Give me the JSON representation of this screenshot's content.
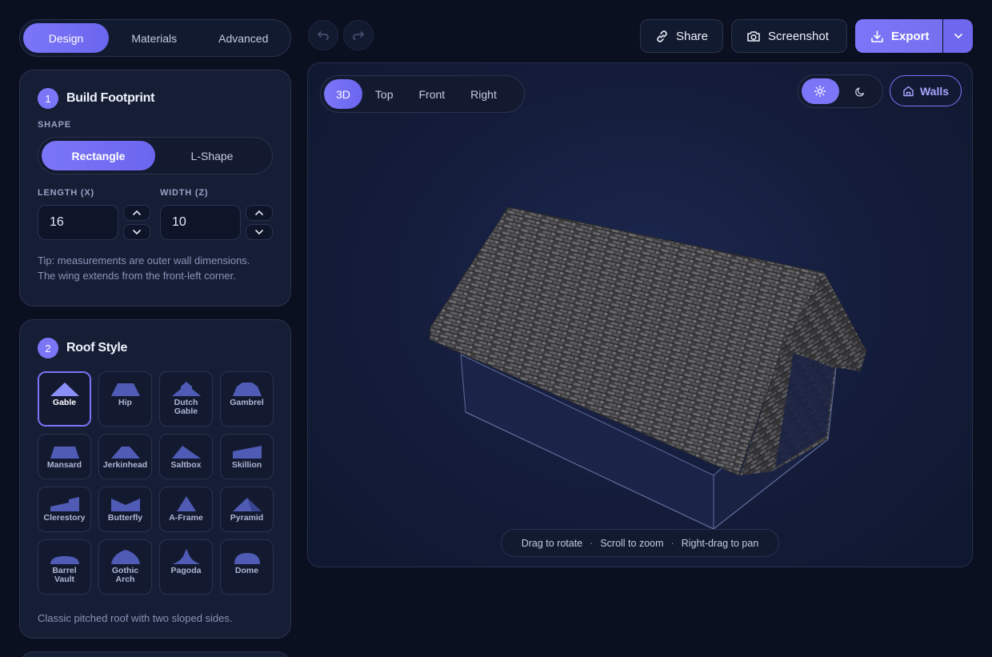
{
  "mode_tabs": [
    "Design",
    "Materials",
    "Advanced"
  ],
  "footprint": {
    "step": "1",
    "title": "Build Footprint",
    "shape_label": "SHAPE",
    "shapes": [
      "Rectangle",
      "L-Shape"
    ],
    "length_label": "LENGTH (X)",
    "length_value": "16",
    "width_label": "WIDTH (Z)",
    "width_value": "10",
    "tip_line1": "Tip: measurements are outer wall dimensions.",
    "tip_line2": "The wing extends from the front-left corner."
  },
  "roof": {
    "step": "2",
    "title": "Roof Style",
    "styles": [
      {
        "l1": "Gable",
        "l2": "",
        "icon": "gable-icon"
      },
      {
        "l1": "Hip",
        "l2": "",
        "icon": "hip-icon"
      },
      {
        "l1": "Dutch",
        "l2": "Gable",
        "icon": "dutch-gable-icon"
      },
      {
        "l1": "Gambrel",
        "l2": "",
        "icon": "gambrel-icon"
      },
      {
        "l1": "Mansard",
        "l2": "",
        "icon": "mansard-icon"
      },
      {
        "l1": "Jerkinhead",
        "l2": "",
        "icon": "jerkinhead-icon"
      },
      {
        "l1": "Saltbox",
        "l2": "",
        "icon": "saltbox-icon"
      },
      {
        "l1": "Skillion",
        "l2": "",
        "icon": "skillion-icon"
      },
      {
        "l1": "Clerestory",
        "l2": "",
        "icon": "clerestory-icon"
      },
      {
        "l1": "Butterfly",
        "l2": "",
        "icon": "butterfly-icon"
      },
      {
        "l1": "A-Frame",
        "l2": "",
        "icon": "a-frame-icon"
      },
      {
        "l1": "Pyramid",
        "l2": "",
        "icon": "pyramid-icon"
      },
      {
        "l1": "Barrel",
        "l2": "Vault",
        "icon": "barrel-vault-icon"
      },
      {
        "l1": "Gothic",
        "l2": "Arch",
        "icon": "gothic-arch-icon"
      },
      {
        "l1": "Pagoda",
        "l2": "",
        "icon": "pagoda-icon"
      },
      {
        "l1": "Dome",
        "l2": "",
        "icon": "dome-icon"
      }
    ],
    "description": "Classic pitched roof with two sloped sides."
  },
  "toolbar": {
    "share": "Share",
    "screenshot": "Screenshot",
    "export": "Export"
  },
  "viewport": {
    "views": [
      "3D",
      "Top",
      "Front",
      "Right"
    ],
    "walls": "Walls",
    "hints": [
      "Drag to rotate",
      "Scroll to zoom",
      "Right-drag to pan"
    ],
    "separator": "·"
  },
  "colors": {
    "accent": "#7b76f8",
    "background": "#0b1020",
    "panel": "#161e36",
    "roof_icon": "#4f5bb5"
  }
}
